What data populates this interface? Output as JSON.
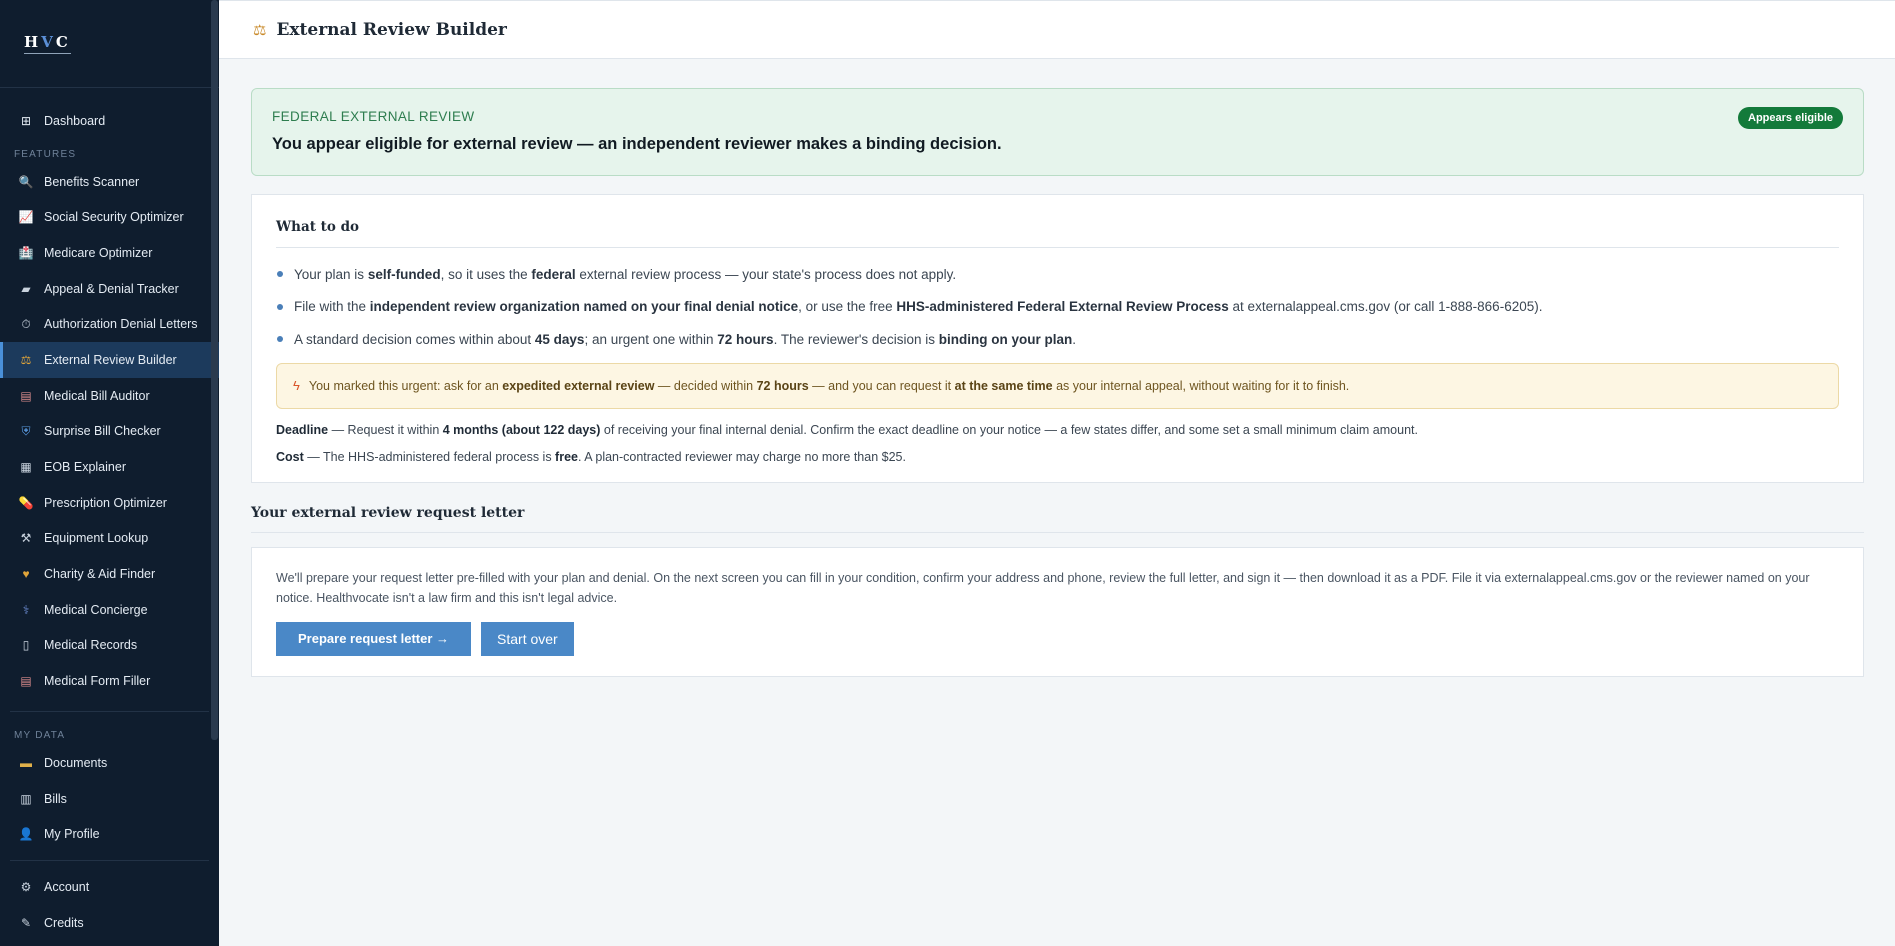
{
  "brand": {
    "h": "H",
    "v": "V",
    "c": "C"
  },
  "sidebar": {
    "dashboard": {
      "icon": "grid-icon",
      "label": "Dashboard"
    },
    "features_label": "FEATURES",
    "features": [
      {
        "icon": "magnifier-icon",
        "label": "Benefits Scanner"
      },
      {
        "icon": "chart-icon",
        "label": "Social Security Optimizer"
      },
      {
        "icon": "hospital-icon",
        "label": "Medicare Optimizer"
      },
      {
        "icon": "folder-icon",
        "label": "Appeal & Denial Tracker"
      },
      {
        "icon": "stopwatch-icon",
        "label": "Authorization Denial Letters"
      },
      {
        "icon": "scales-icon",
        "label": "External Review Builder"
      },
      {
        "icon": "clipboard-icon",
        "label": "Medical Bill Auditor"
      },
      {
        "icon": "shield-icon",
        "label": "Surprise Bill Checker"
      },
      {
        "icon": "document-icon",
        "label": "EOB Explainer"
      },
      {
        "icon": "pill-icon",
        "label": "Prescription Optimizer"
      },
      {
        "icon": "tools-icon",
        "label": "Equipment Lookup"
      },
      {
        "icon": "heart-icon",
        "label": "Charity & Aid Finder"
      },
      {
        "icon": "stethoscope-icon",
        "label": "Medical Concierge"
      },
      {
        "icon": "page-icon",
        "label": "Medical Records"
      },
      {
        "icon": "clipboard-icon",
        "label": "Medical Form Filler"
      }
    ],
    "active_index": 5,
    "mydata_label": "MY DATA",
    "mydata": [
      {
        "icon": "folder-icon",
        "label": "Documents"
      },
      {
        "icon": "receipt-icon",
        "label": "Bills"
      },
      {
        "icon": "person-icon",
        "label": "My Profile"
      }
    ],
    "account": {
      "icon": "gear-icon",
      "label": "Account"
    },
    "credits": {
      "icon": "ticket-icon",
      "label": "Credits"
    }
  },
  "header": {
    "icon": "scales-icon",
    "title": "External Review Builder"
  },
  "banner": {
    "label": "FEDERAL EXTERNAL REVIEW",
    "headline": "You appear eligible for external review — an independent reviewer makes a binding decision.",
    "badge": "Appears eligible",
    "bg_color": "#e6f4ec",
    "badge_color": "#137a3a"
  },
  "todo": {
    "title": "What to do",
    "b1": {
      "a": "Your plan is ",
      "b": "self-funded",
      "c": ", so it uses the ",
      "d": "federal",
      "e": " external review process — your state's process does not apply."
    },
    "b2": {
      "a": "File with the ",
      "b": "independent review organization named on your final denial notice",
      "c": ", or use the free ",
      "d": "HHS-administered Federal External Review Process",
      "e": " at externalappeal.cms.gov (or call 1-888-866-6205)."
    },
    "b3": {
      "a": "A standard decision comes within about ",
      "b": "45 days",
      "c": "; an urgent one within ",
      "d": "72 hours",
      "e": ". The reviewer's decision is ",
      "f": "binding on your plan",
      "g": "."
    },
    "urgent": {
      "a": "You marked this urgent: ask for an ",
      "b": "expedited external review",
      "c": " — decided within ",
      "d": "72 hours",
      "e": " — and you can request it ",
      "f": "at the same time",
      "g": " as your internal appeal, without waiting for it to finish."
    },
    "deadline": {
      "a": "Deadline",
      "b": " — Request it within ",
      "c": "4 months (about 122 days)",
      "d": " of receiving your final internal denial. Confirm the exact deadline on your notice — a few states differ, and some set a small minimum claim amount."
    },
    "cost": {
      "a": "Cost",
      "b": " — The HHS-administered federal process is ",
      "c": "free",
      "d": ". A plan-contracted reviewer may charge no more than $25."
    }
  },
  "letter": {
    "title": "Your external review request letter",
    "body": "We'll prepare your request letter pre-filled with your plan and denial. On the next screen you can fill in your condition, confirm your address and phone, review the full letter, and sign it — then download it as a PDF. File it via externalappeal.cms.gov or the reviewer named on your notice. Healthvocate isn't a law firm and this isn't legal advice.",
    "primary_label": "Prepare request letter →",
    "secondary_label": "Start over",
    "button_color": "#4a88c7"
  }
}
